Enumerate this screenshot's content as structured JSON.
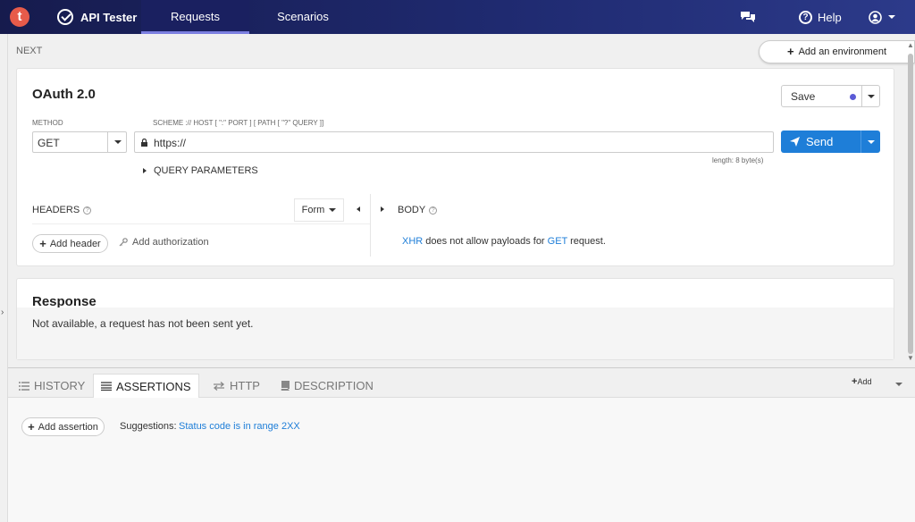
{
  "topbar": {
    "logo_letter": "t",
    "app_title": "API Tester",
    "tabs": [
      {
        "label": "Requests",
        "active": true
      },
      {
        "label": "Scenarios",
        "active": false
      }
    ],
    "help_label": "Help",
    "icons": [
      "chat-icon",
      "help-icon",
      "user-icon"
    ]
  },
  "workspace": {
    "next_label": "NEXT",
    "add_env_label": "Add an environment"
  },
  "request": {
    "title": "OAuth 2.0",
    "save_label": "Save",
    "method_label": "METHOD",
    "method_value": "GET",
    "url_label": "SCHEME :// HOST [ \":\" PORT ] [ PATH [ \"?\" QUERY ]]",
    "url_value": "https://",
    "send_label": "Send",
    "length_info": "length: 8 byte(s)",
    "query_params_label": "QUERY PARAMETERS",
    "headers_label": "HEADERS",
    "form_label": "Form",
    "body_label": "BODY",
    "add_header_label": "Add header",
    "add_auth_label": "Add authorization",
    "body_msg": {
      "link1": "XHR",
      "text1": " does not allow payloads for ",
      "link2": "GET",
      "text2": " request."
    }
  },
  "response": {
    "title": "Response",
    "message": "Not available, a request has not been sent yet."
  },
  "bottom": {
    "tabs": [
      {
        "label": "HISTORY",
        "icon": "list-icon",
        "active": false
      },
      {
        "label": "ASSERTIONS",
        "icon": "assertions-icon",
        "active": true
      },
      {
        "label": "HTTP",
        "icon": "exchange-icon",
        "active": false
      },
      {
        "label": "DESCRIPTION",
        "icon": "book-icon",
        "active": false
      }
    ],
    "add_label": "Add",
    "add_assertion_label": "Add assertion",
    "suggestions_label": "Suggestions:",
    "suggestion_link": "Status code is in range 2XX"
  },
  "colors": {
    "accent": "#1e7ed8",
    "topbar": "#1f2a70",
    "save_dot": "#5b5bd6",
    "logo": "#e75b4a"
  }
}
